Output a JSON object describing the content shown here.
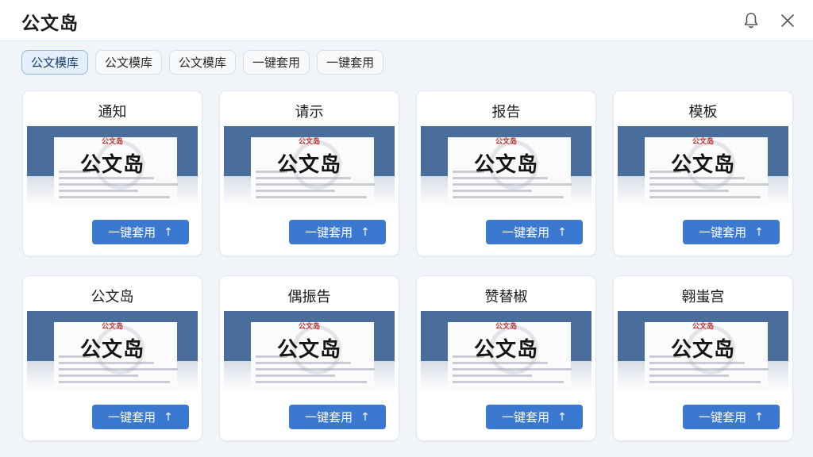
{
  "app": {
    "title": "公文岛"
  },
  "header_icons": {
    "bell": "bell-icon",
    "close": "close-icon"
  },
  "tabs": [
    {
      "label": "公文模库",
      "active": true
    },
    {
      "label": "公文模库",
      "active": false
    },
    {
      "label": "公文模库",
      "active": false
    },
    {
      "label": "一键套用",
      "active": false
    },
    {
      "label": "一键套用",
      "active": false
    }
  ],
  "cards": [
    {
      "title": "通知",
      "mark": "公文岛",
      "preview": "公文岛",
      "button": "一键套用",
      "button_icon": "↑"
    },
    {
      "title": "请示",
      "mark": "公文岛",
      "preview": "公文岛",
      "button": "一键套用",
      "button_icon": "↑"
    },
    {
      "title": "报告",
      "mark": "公文岛",
      "preview": "公文岛",
      "button": "一键套用",
      "button_icon": "↑"
    },
    {
      "title": "模板",
      "mark": "公文岛",
      "preview": "公文岛",
      "button": "一键套用",
      "button_icon": "↑"
    },
    {
      "title": "公文岛",
      "mark": "公文岛",
      "preview": "公文岛",
      "button": "一键套用",
      "button_icon": "↑"
    },
    {
      "title": "偶振告",
      "mark": "公文岛",
      "preview": "公文岛",
      "button": "一键套用",
      "button_icon": "↑"
    },
    {
      "title": "赞替椒",
      "mark": "公文岛",
      "preview": "公文岛",
      "button": "一键套用",
      "button_icon": "↑"
    },
    {
      "title": "翱蚩宫",
      "mark": "公文岛",
      "preview": "公文岛",
      "button": "一键套用",
      "button_icon": "↑"
    }
  ],
  "colors": {
    "accent": "#3b78d0",
    "thumb_frame": "#4a6e9c",
    "mark_red": "#c0352b"
  }
}
